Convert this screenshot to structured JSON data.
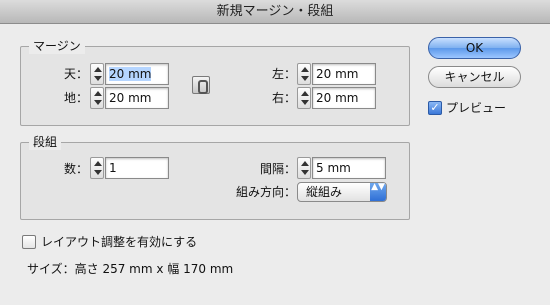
{
  "window": {
    "title": "新規マージン・段組"
  },
  "margin": {
    "title": "マージン",
    "top": {
      "label": "天：",
      "value": "20 mm"
    },
    "bottom": {
      "label": "地：",
      "value": "20 mm"
    },
    "left": {
      "label": "左：",
      "value": "20 mm"
    },
    "right": {
      "label": "右：",
      "value": "20 mm"
    }
  },
  "columns": {
    "title": "段組",
    "count": {
      "label": "数：",
      "value": "1"
    },
    "gutter": {
      "label": "間隔：",
      "value": "5 mm"
    },
    "direction": {
      "label": "組み方向：",
      "value": "縦組み"
    }
  },
  "layout_adjust": {
    "label": "レイアウト調整を有効にする",
    "checked": false
  },
  "size_info": "サイズ：高さ 257 mm x 幅 170 mm",
  "buttons": {
    "ok": "OK",
    "cancel": "キャンセル"
  },
  "preview": {
    "label": "プレビュー",
    "checked": true
  },
  "icons": {
    "checkmark": "✓",
    "select_arrows": "▲▼"
  }
}
